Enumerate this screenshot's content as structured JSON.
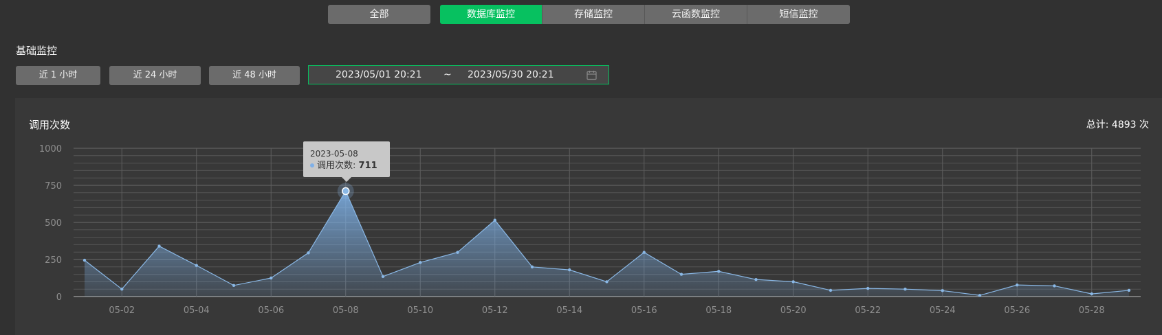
{
  "tabs": {
    "all_label": "全部",
    "items": [
      "数据库监控",
      "存储监控",
      "云函数监控",
      "短信监控"
    ],
    "active_index": 0
  },
  "section_title": "基础监控",
  "quick_ranges": [
    "近 1 小时",
    "近 24 小时",
    "近 48 小时"
  ],
  "date_range": {
    "start": "2023/05/01 20:21",
    "separator": "~",
    "end": "2023/05/30 20:21",
    "icon": "calendar-icon"
  },
  "chart_title": "调用次数",
  "total_label": "总计: 4893 次",
  "tooltip": {
    "date": "2023-05-08",
    "series": "调用次数",
    "value": "711"
  },
  "colors": {
    "accent": "#07c160",
    "line": "#8ab8e6",
    "background": "#313131",
    "panel": "#383838"
  },
  "chart_data": {
    "type": "area",
    "series": [
      {
        "name": "调用次数",
        "values": [
          245,
          50,
          340,
          210,
          75,
          125,
          295,
          711,
          135,
          230,
          298,
          515,
          200,
          180,
          100,
          298,
          150,
          170,
          115,
          100,
          42,
          55,
          50,
          40,
          8,
          78,
          72,
          18,
          42
        ]
      }
    ],
    "x": [
      "05-01",
      "05-02",
      "05-03",
      "05-04",
      "05-05",
      "05-06",
      "05-07",
      "05-08",
      "05-09",
      "05-10",
      "05-11",
      "05-12",
      "05-13",
      "05-14",
      "05-15",
      "05-16",
      "05-17",
      "05-18",
      "05-19",
      "05-20",
      "05-21",
      "05-22",
      "05-23",
      "05-24",
      "05-25",
      "05-26",
      "05-27",
      "05-28",
      "05-29"
    ],
    "x_tick_labels": [
      "05-02",
      "05-04",
      "05-06",
      "05-08",
      "05-10",
      "05-12",
      "05-14",
      "05-16",
      "05-18",
      "05-20",
      "05-22",
      "05-24",
      "05-26",
      "05-28"
    ],
    "y_ticks": [
      0,
      250,
      500,
      750,
      1000
    ],
    "ylim": [
      0,
      1000
    ],
    "grid": true,
    "highlight_index": 7
  }
}
